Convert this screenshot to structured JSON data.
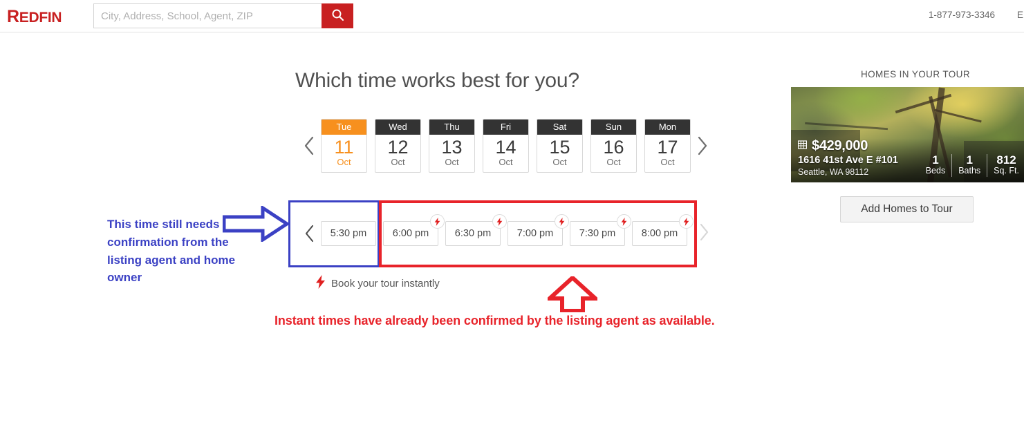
{
  "header": {
    "logo": "REDFIN",
    "logo_cap": "R",
    "logo_rest": "EDFIN",
    "search_placeholder": "City, Address, School, Agent, ZIP",
    "search_value": "",
    "search_icon": "search-icon",
    "phone": "1-877-973-3346",
    "edge_partial": "E"
  },
  "main": {
    "title": "Which time works best for you?",
    "prev_label": "‹",
    "next_label": "›"
  },
  "dates": [
    {
      "dow": "Tue",
      "day": "11",
      "month": "Oct",
      "selected": true
    },
    {
      "dow": "Wed",
      "day": "12",
      "month": "Oct",
      "selected": false
    },
    {
      "dow": "Thu",
      "day": "13",
      "month": "Oct",
      "selected": false
    },
    {
      "dow": "Fri",
      "day": "14",
      "month": "Oct",
      "selected": false
    },
    {
      "dow": "Sat",
      "day": "15",
      "month": "Oct",
      "selected": false
    },
    {
      "dow": "Sun",
      "day": "16",
      "month": "Oct",
      "selected": false
    },
    {
      "dow": "Mon",
      "day": "17",
      "month": "Oct",
      "selected": false
    }
  ],
  "times": [
    {
      "label": "5:30 pm",
      "instant": false
    },
    {
      "label": "6:00 pm",
      "instant": true
    },
    {
      "label": "6:30 pm",
      "instant": true
    },
    {
      "label": "7:00 pm",
      "instant": true
    },
    {
      "label": "7:30 pm",
      "instant": true
    },
    {
      "label": "8:00 pm",
      "instant": true
    }
  ],
  "legend": {
    "text": "Book your tour instantly",
    "icon": "lightning-bolt-icon"
  },
  "right_panel": {
    "section_label": "HOMES IN YOUR TOUR",
    "home": {
      "price": "$429,000",
      "address_line1": "1616 41st Ave E #101",
      "address_line2": "Seattle, WA 98112",
      "beds_value": "1",
      "beds_label": "Beds",
      "baths_value": "1",
      "baths_label": "Baths",
      "sqft_value": "812",
      "sqft_label": "Sq. Ft."
    },
    "add_homes_label": "Add Homes to Tour"
  },
  "annotations": {
    "blue_text": "This time still needs confirmation from the listing agent and home owner",
    "red_text": "Instant times have already been confirmed by the listing agent as available.",
    "blue_color": "#3b41c4",
    "red_color": "#e8232a"
  },
  "colors": {
    "brand_red": "#c82021",
    "selected_orange": "#f7901e",
    "dow_dark": "#333333"
  }
}
